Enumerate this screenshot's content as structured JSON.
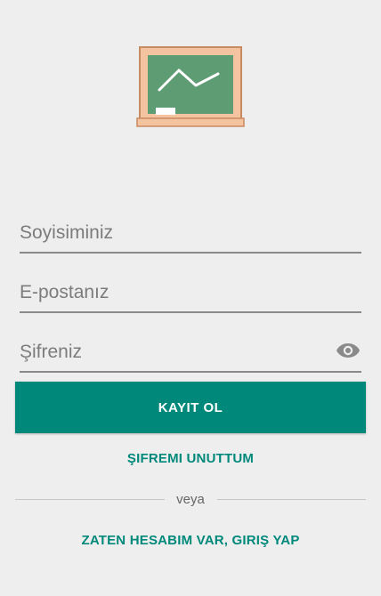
{
  "form": {
    "surname_placeholder": "Soyisiminiz",
    "email_placeholder": "E-postanız",
    "password_placeholder": "Şifreniz"
  },
  "actions": {
    "register_label": "KAYIT OL",
    "forgot_password_label": "ŞIFREMI UNUTTUM",
    "divider_label": "veya",
    "login_label": "ZATEN HESABIM VAR, GIRIŞ YAP"
  },
  "icons": {
    "logo": "chalkboard-icon",
    "password_toggle": "eye-icon"
  },
  "colors": {
    "accent": "#00897b",
    "background": "#eeeeee",
    "chalkboard": "#5e9c74",
    "chalkboard_frame": "#f4c4a0"
  }
}
